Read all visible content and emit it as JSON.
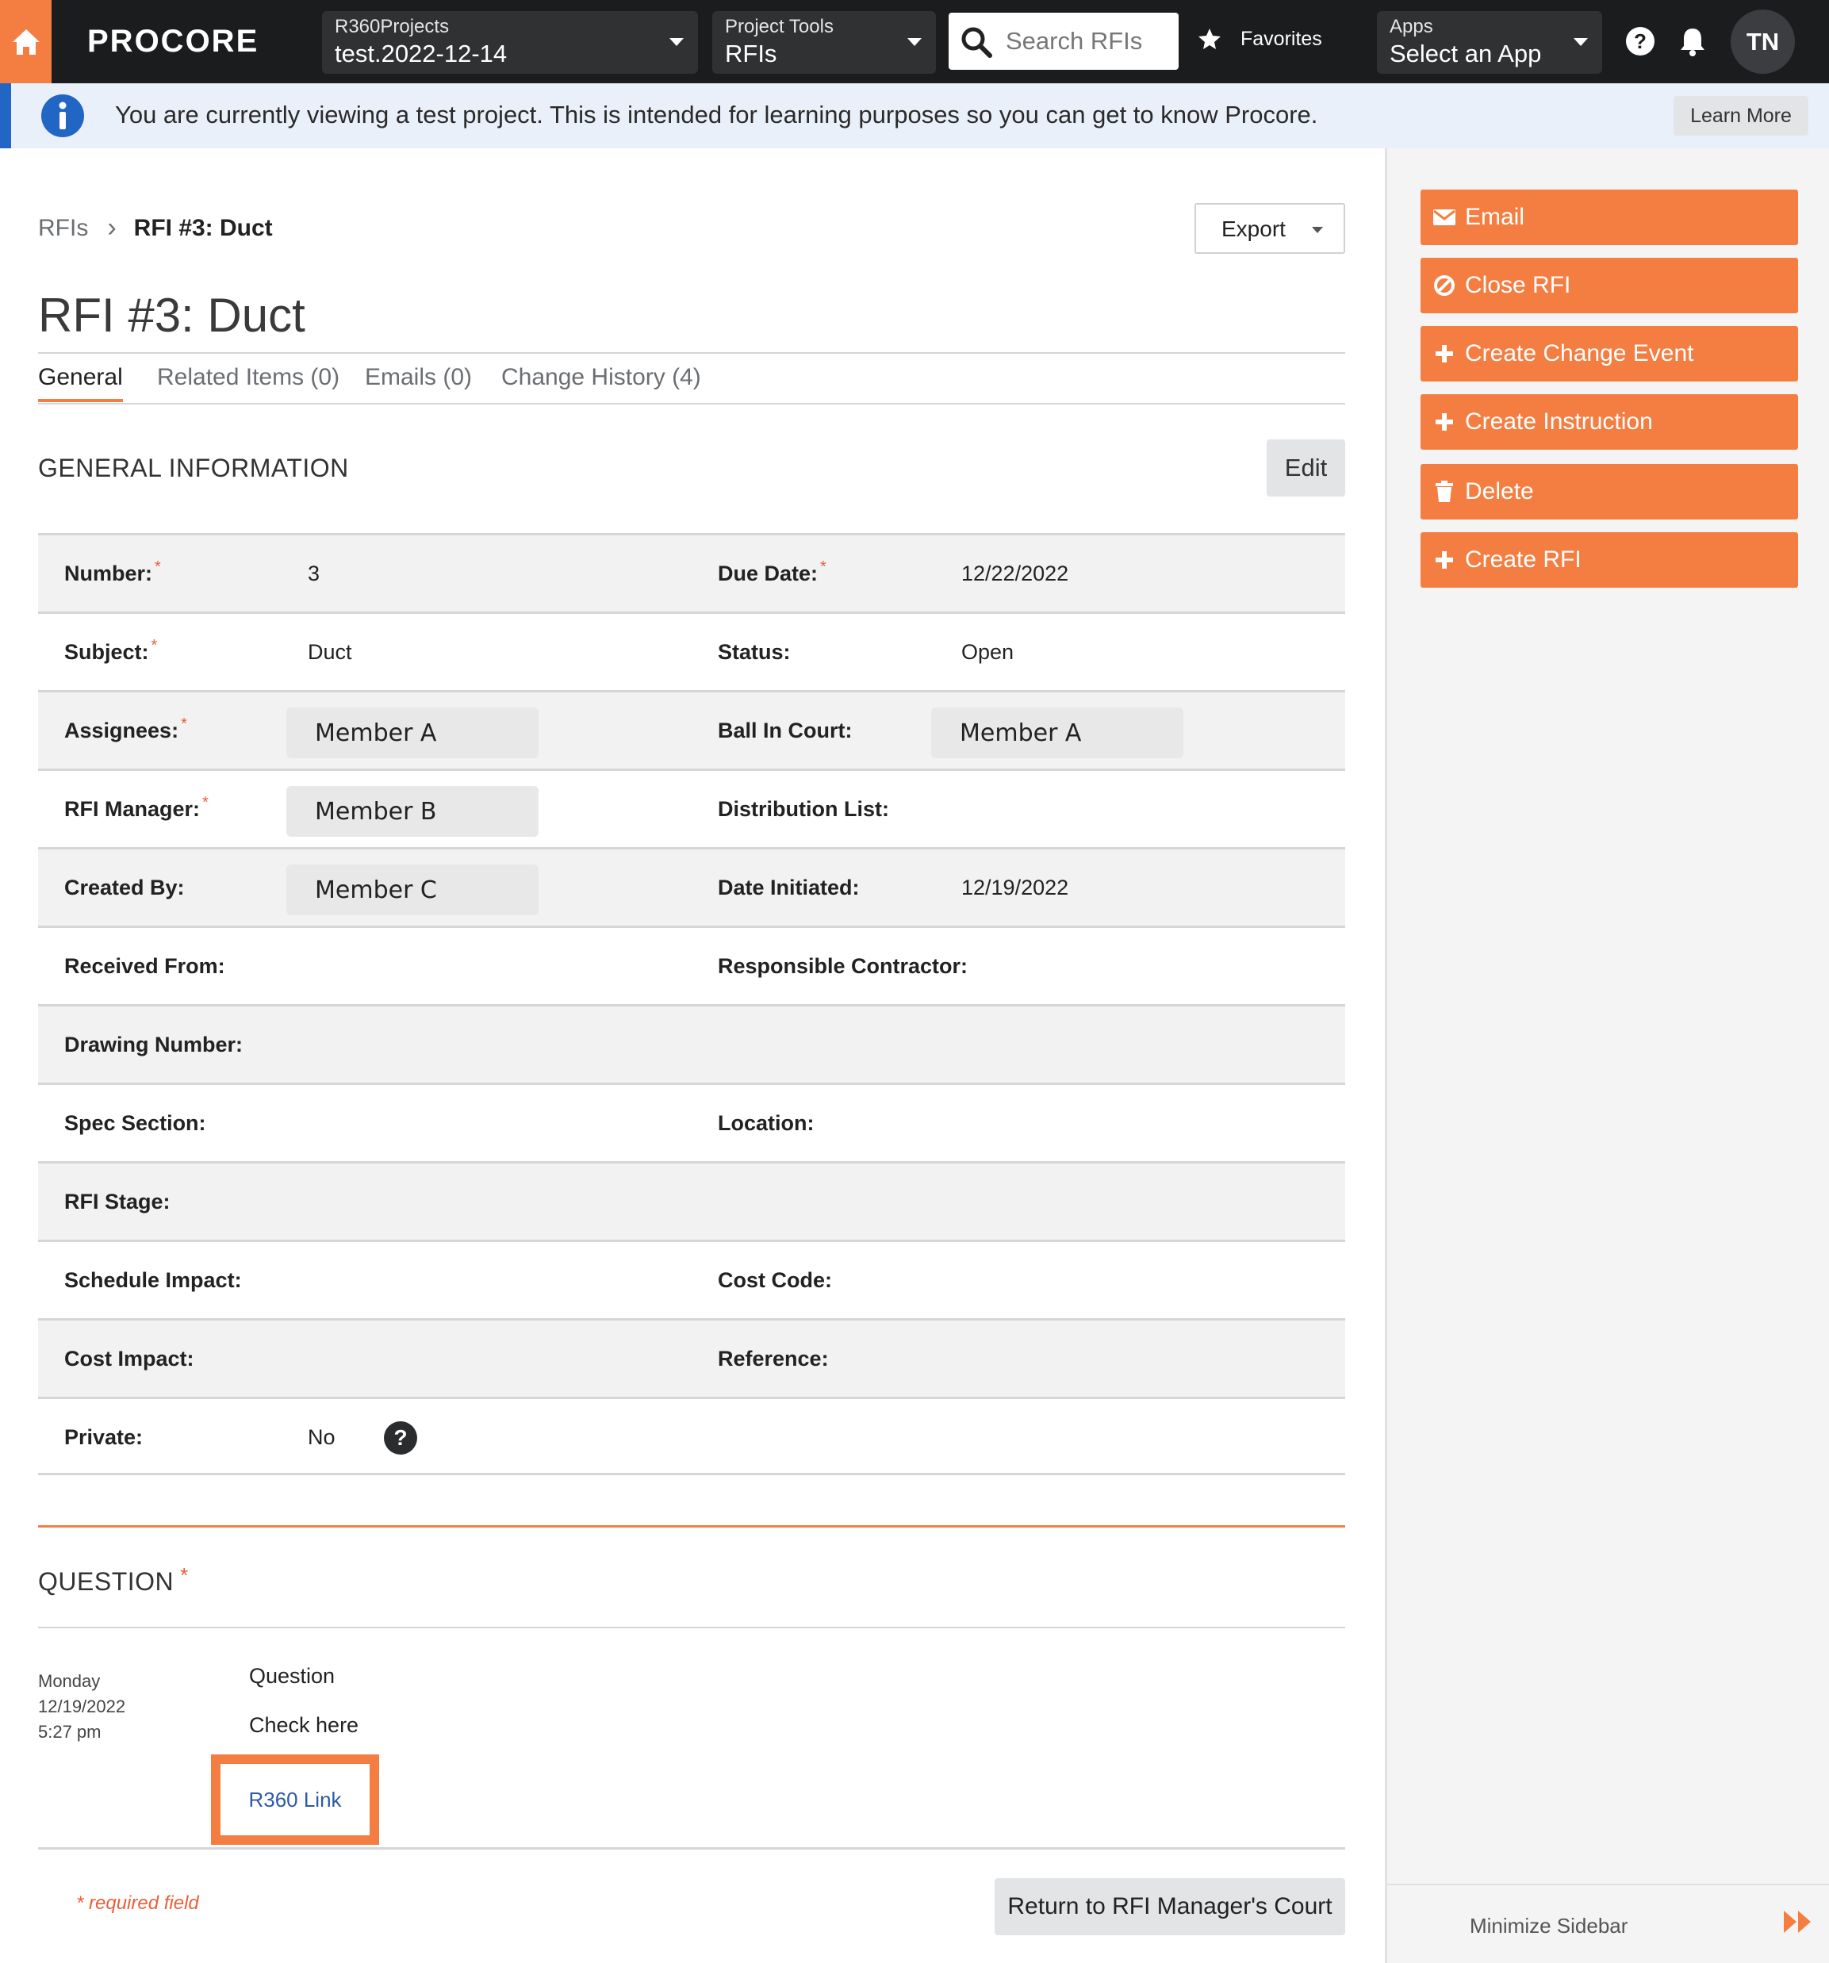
{
  "topnav": {
    "logo": "PROCORE",
    "project_selector": {
      "label": "R360Projects",
      "value": "test.2022-12-14"
    },
    "tool_selector": {
      "label": "Project Tools",
      "value": "RFIs"
    },
    "search_placeholder": "Search RFIs",
    "favorites_label": "Favorites",
    "apps_selector": {
      "label": "Apps",
      "value": "Select an App"
    },
    "avatar_initials": "TN"
  },
  "banner": {
    "message": "You are currently viewing a test project. This is intended for learning purposes so you can get to know Procore.",
    "learn_more": "Learn More"
  },
  "breadcrumb": {
    "root": "RFIs",
    "current": "RFI #3: Duct"
  },
  "export_label": "Export",
  "page_title": "RFI #3: Duct",
  "tabs": [
    {
      "label": "General",
      "active": true
    },
    {
      "label": "Related Items (0)"
    },
    {
      "label": "Emails (0)"
    },
    {
      "label": "Change History (4)"
    }
  ],
  "general": {
    "heading": "GENERAL INFORMATION",
    "edit_label": "Edit",
    "rows": [
      {
        "left": {
          "label": "Number:",
          "value": "3"
        },
        "right": {
          "label": "Due Date:",
          "value": "12/22/2022"
        }
      },
      {
        "left": {
          "label": "Subject:",
          "value": "Duct"
        },
        "right": {
          "label": "Status:",
          "value": "Open"
        }
      },
      {
        "left": {
          "label": "Assignees:",
          "value": "Member A"
        },
        "right": {
          "label": "Ball In Court:",
          "value": "Member A"
        }
      },
      {
        "left": {
          "label": "RFI Manager:",
          "value": "Member B"
        },
        "right": {
          "label": "Distribution List:",
          "value": ""
        }
      },
      {
        "left": {
          "label": "Created By:",
          "value": "Member C"
        },
        "right": {
          "label": "Date Initiated:",
          "value": "12/19/2022"
        }
      },
      {
        "left": {
          "label": "Received From:",
          "value": ""
        },
        "right": {
          "label": "Responsible Contractor:",
          "value": ""
        }
      },
      {
        "left": {
          "label": "Drawing Number:",
          "value": ""
        }
      },
      {
        "left": {
          "label": "Spec Section:",
          "value": ""
        },
        "right": {
          "label": "Location:",
          "value": ""
        }
      },
      {
        "left": {
          "label": "RFI Stage:",
          "value": ""
        }
      },
      {
        "left": {
          "label": "Schedule Impact:",
          "value": ""
        },
        "right": {
          "label": "Cost Code:",
          "value": ""
        }
      },
      {
        "left": {
          "label": "Cost Impact:",
          "value": ""
        },
        "right": {
          "label": "Reference:",
          "value": ""
        }
      },
      {
        "left": {
          "label": "Private:",
          "value": "No"
        }
      }
    ],
    "required_marker": "*"
  },
  "question": {
    "heading": "QUESTION",
    "day": "Monday",
    "date": "12/19/2022",
    "time": "5:27 pm",
    "line1": "Question",
    "line2": "Check here",
    "link": "R360 Link"
  },
  "required_note": "* required field",
  "return_button": "Return to RFI Manager's Court",
  "sidebar": {
    "actions": [
      {
        "label": "Email",
        "icon": "envelope-icon"
      },
      {
        "label": "Close RFI",
        "icon": "ban-icon"
      },
      {
        "label": "Create Change Event",
        "icon": "plus-icon"
      },
      {
        "label": "Create Instruction",
        "icon": "plus-icon"
      },
      {
        "label": "Delete",
        "icon": "trash-icon"
      },
      {
        "label": "Create RFI",
        "icon": "plus-icon"
      }
    ],
    "minimize_label": "Minimize Sidebar"
  },
  "colors": {
    "accent": "#f47e42",
    "nav": "#1b1c1e",
    "banner": "#eaf0fa",
    "info": "#2266c5",
    "link": "#2b5aa8"
  }
}
